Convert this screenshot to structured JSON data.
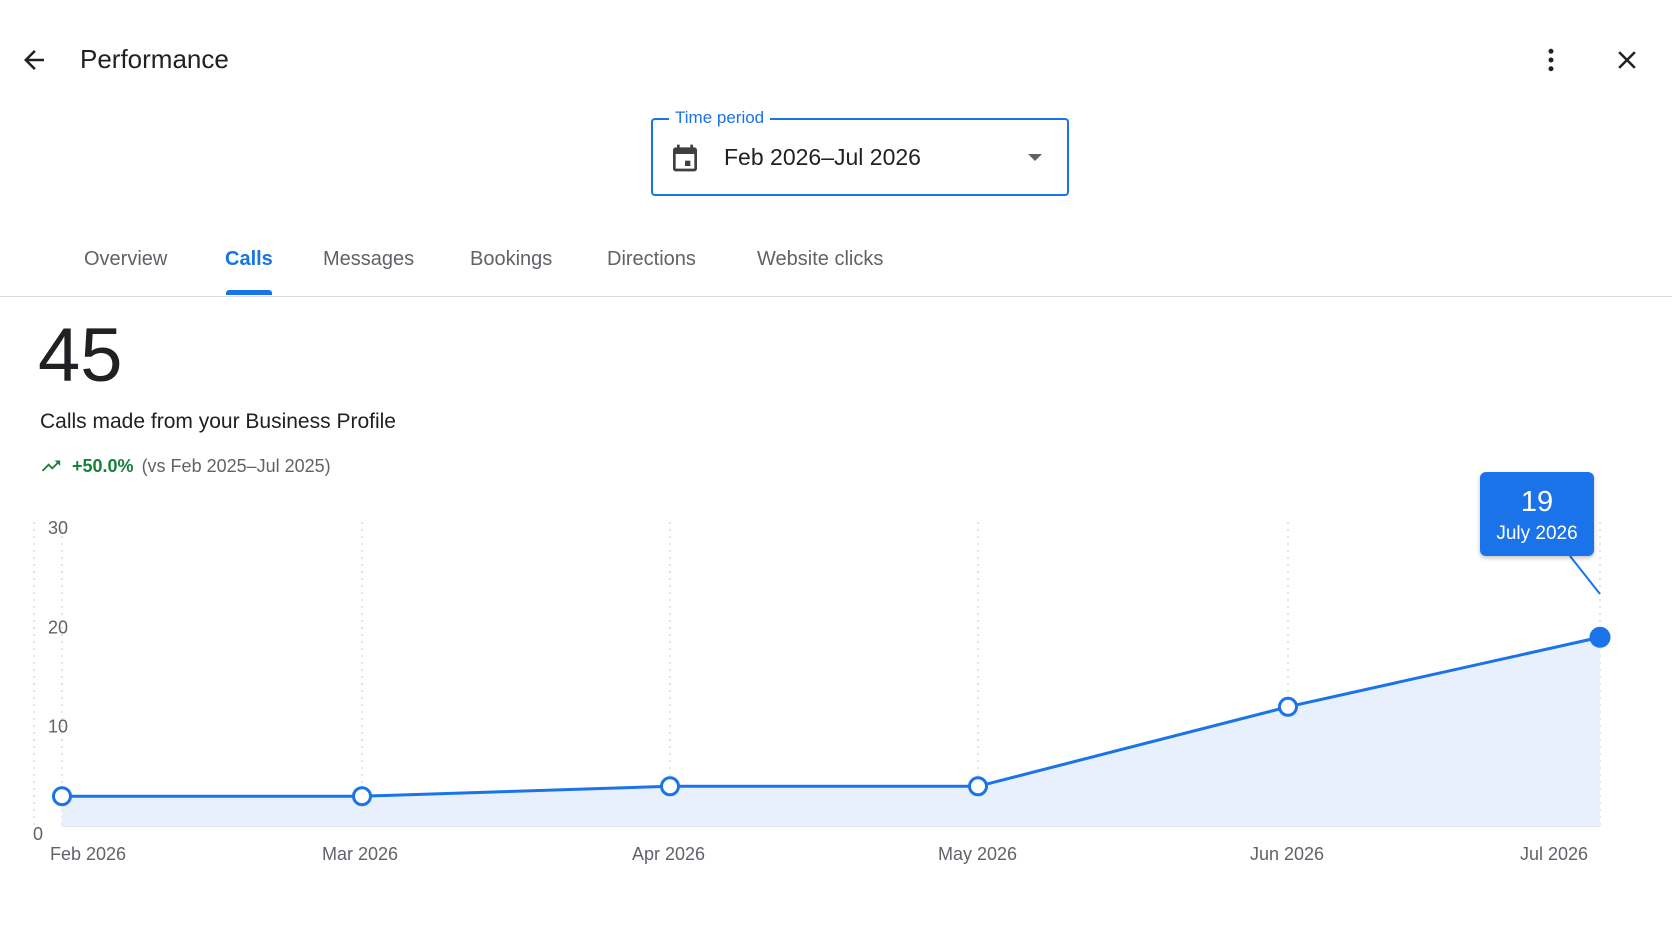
{
  "header": {
    "title": "Performance",
    "back_icon": "arrow-back-icon",
    "more_icon": "more-vert-icon",
    "close_icon": "close-icon"
  },
  "time_period": {
    "label": "Time period",
    "value": "Feb 2026–Jul 2026",
    "icon": "calendar-icon"
  },
  "tabs": [
    {
      "label": "Overview",
      "active": false
    },
    {
      "label": "Calls",
      "active": true
    },
    {
      "label": "Messages",
      "active": false
    },
    {
      "label": "Bookings",
      "active": false
    },
    {
      "label": "Directions",
      "active": false
    },
    {
      "label": "Website clicks",
      "active": false
    }
  ],
  "metric": {
    "total": "45",
    "description": "Calls made from your Business Profile",
    "change": "+50.0%",
    "comparison": "(vs Feb 2025–Jul 2025)"
  },
  "tooltip": {
    "value": "19",
    "label": "July 2026"
  },
  "colors": {
    "accent": "#1a73e8",
    "positive": "#188038",
    "area_fill": "#e8f0fe"
  },
  "chart_data": {
    "type": "area",
    "categories": [
      "Feb 2026",
      "Mar 2026",
      "Apr 2026",
      "May 2026",
      "Jun 2026",
      "Jul 2026"
    ],
    "values": [
      3,
      3,
      4,
      4,
      12,
      19
    ],
    "yticks": [
      "0",
      "10",
      "20",
      "30"
    ],
    "ylim": [
      0,
      30
    ],
    "grid": "vertical dotted",
    "highlighted_index": 5
  }
}
